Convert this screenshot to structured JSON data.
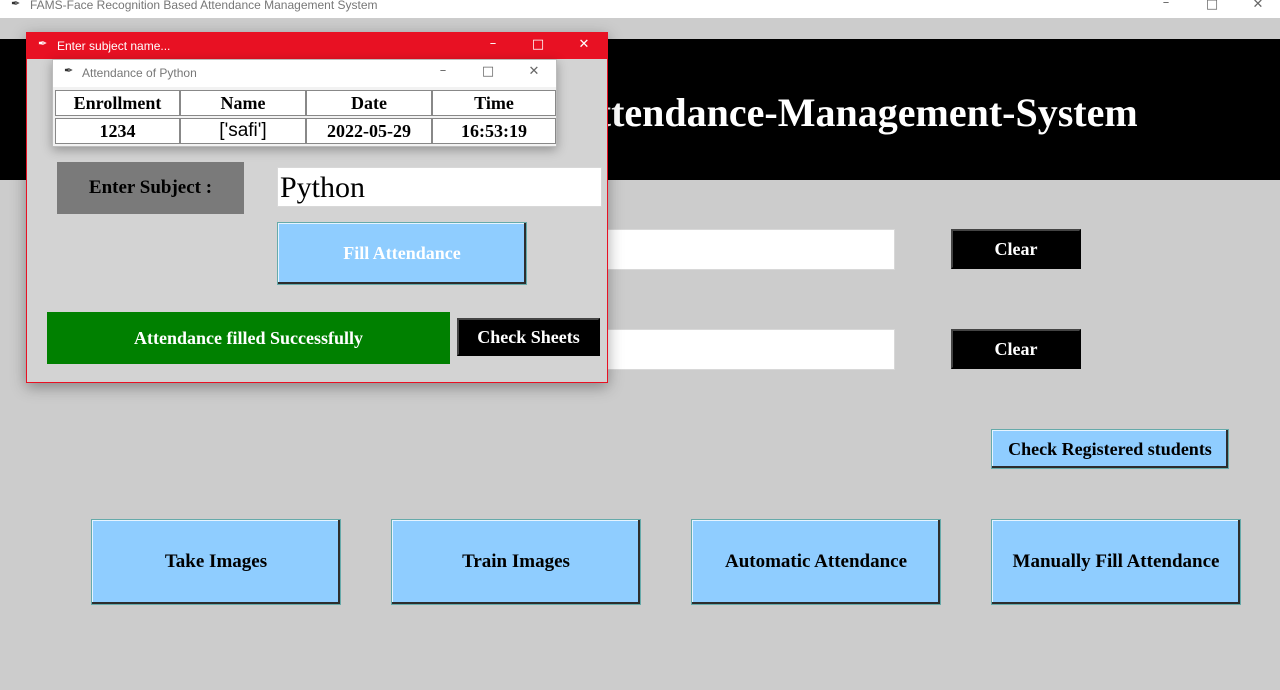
{
  "main_window": {
    "title": "FAMS-Face Recognition Based Attendance Management System",
    "banner_text": "Face-Recognition-Based-Attendance-Management-System",
    "clear_button_1": "Clear",
    "clear_button_2": "Clear",
    "check_registered_label": "Check Registered students",
    "take_images_label": "Take Images",
    "train_images_label": "Train Images",
    "automatic_attendance_label": "Automatic Attendance",
    "manual_attendance_label": "Manually Fill Attendance"
  },
  "subject_dialog": {
    "title": "Enter subject name...",
    "enter_subject_label": "Enter Subject :",
    "subject_value": "Python",
    "fill_attendance_label": "Fill Attendance",
    "status_message": "Attendance filled Successfully",
    "check_sheets_label": "Check Sheets"
  },
  "attendance_window": {
    "title": "Attendance of Python",
    "headers": [
      "Enrollment",
      "Name",
      "Date",
      "Time"
    ],
    "rows": [
      [
        "1234",
        "['safi']",
        "2022-05-29",
        "16:53:19"
      ]
    ]
  },
  "icons": {
    "app_icon": "feather-icon",
    "minimize": "minimize-icon",
    "maximize": "maximize-icon",
    "close": "close-icon"
  },
  "colors": {
    "active_titlebar": "#e81123",
    "button_blue": "#8fcdff",
    "success_green": "#008000",
    "banner_black": "#000000",
    "label_gray": "#7a7a7a"
  }
}
